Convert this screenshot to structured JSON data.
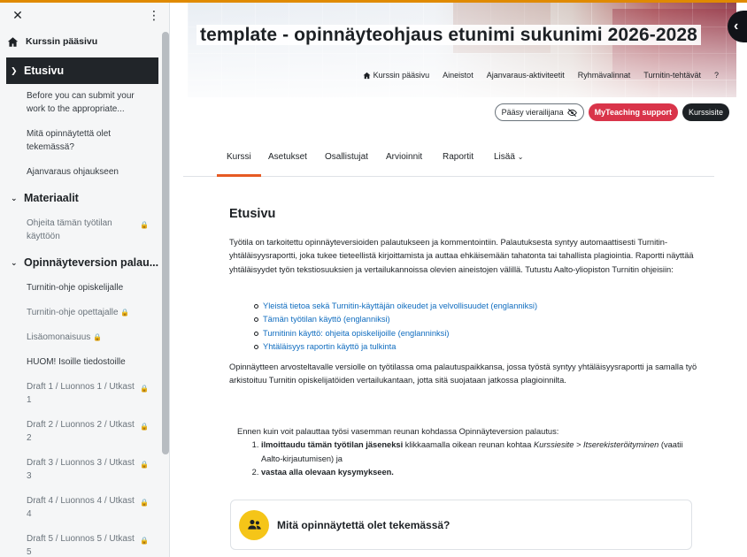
{
  "drawer": {
    "home_label": "Kurssin pääsivu",
    "sections": [
      {
        "title": "Etusivu",
        "active": true,
        "items": [
          {
            "label": "Before you can submit your work to the appropriate...",
            "locked": false
          },
          {
            "label": "Mitä opinnäytettä olet tekemässä?",
            "locked": false
          },
          {
            "label": "Ajanvaraus ohjaukseen",
            "locked": false
          }
        ]
      },
      {
        "title": "Materiaalit",
        "active": false,
        "items": [
          {
            "label": "Ohjeita tämän työtilan käyttöön",
            "locked": true
          }
        ]
      },
      {
        "title": "Opinnäyteversion palau...",
        "active": false,
        "items": [
          {
            "label": "Turnitin-ohje opiskelijalle",
            "locked": false
          },
          {
            "label": "Turnitin-ohje opettajalle",
            "locked": true
          },
          {
            "label": "Lisäomonaisuus",
            "locked": true
          },
          {
            "label": "HUOM! Isoille tiedostoille",
            "locked": false
          },
          {
            "label": "Draft 1 / Luonnos 1 / Utkast 1",
            "locked": true
          },
          {
            "label": "Draft 2 / Luonnos 2 / Utkast 2",
            "locked": true
          },
          {
            "label": "Draft 3 / Luonnos 3 / Utkast 3",
            "locked": true
          },
          {
            "label": "Draft 4 / Luonnos 4 / Utkast 4",
            "locked": true
          },
          {
            "label": "Draft 5 / Luonnos 5 / Utkast 5",
            "locked": true
          }
        ]
      }
    ]
  },
  "header": {
    "title": "template - opinnäyteohjaus etunimi sukunimi 2026-2028",
    "menu": [
      "Kurssin pääsivu",
      "Aineistot",
      "Ajanvaraus-aktiviteetit",
      "Ryhmävalinnat",
      "Turnitin-tehtävät",
      "?"
    ]
  },
  "actions": {
    "guest_access": "Pääsy vierailijana",
    "support": "MyTeaching support",
    "course_page": "Kurssisite"
  },
  "secondary_nav": {
    "tabs": [
      "Kurssi",
      "Asetukset",
      "Osallistujat",
      "Arvioinnit",
      "Raportit",
      "Lisää"
    ],
    "active": "Kurssi"
  },
  "content": {
    "heading": "Etusivu",
    "paragraph1": "Työtila on tarkoitettu opinnäyteversioiden palautukseen ja kommentointiin. Palautuksesta syntyy automaattisesti Turnitin-yhtäläisyysraportti, joka tukee tieteellistä kirjoittamista ja auttaa ehkäisemään tahatonta tai tahallista plagiointia. Raportti näyttää yhtäläisyydet työn tekstiosuuksien ja vertailukannoissa olevien aineistojen välillä. Tutustu Aalto-yliopiston Turnitin ohjeisiin:",
    "links": [
      "Yleistä tietoa sekä Turnitin-käyttäjän oikeudet ja velvollisuudet (englanniksi)",
      "Tämän työtilan käyttö (englanniksi)",
      "Turnitinin käyttö: ohjeita opiskelijoille (englanninksi)",
      "Yhtäläisyys raportin käyttö ja tulkinta"
    ],
    "paragraph2": "Opinnäytteen arvosteltavalle versiolle on työtilassa oma palautuspaikkansa, jossa työstä syntyy yhtäläisyysraportti ja samalla työ arkistoituu Turnitin opiskelijatöiden vertailukantaan, jotta sitä suojataan jatkossa plagioinnilta.",
    "steps_intro": "Ennen kuin voit palauttaa työsi vasemman reunan kohdassa Opinnäyteversion palautus:",
    "step1_bold": "ilmoittaudu tämän työtilan jäseneksi",
    "step1_mid": " klikkaamalla oikean reunan kohtaa ",
    "step1_italic": "Kurssiesite > Itserekisteröityminen",
    "step1_end": " (vaatii Aalto-kirjautumisen) ja",
    "step2_bold": "vastaa alla olevaan kysymykseen.",
    "activity_name": "Mitä opinnäytettä olet tekemässä?"
  },
  "icons": {
    "close": "close-icon",
    "kebab": "kebab-menu-icon",
    "home": "home-icon",
    "chevron": "chevron-down-icon",
    "lock": "lock-icon",
    "eye_slash": "eye-slash-icon",
    "back": "chevron-left-icon",
    "users": "users-icon"
  },
  "colors": {
    "accent_underline": "#e65a23",
    "support_button": "#d9344a",
    "activity_icon_bg": "#f5c518",
    "link": "#0f6cbf",
    "drawer_active_bg": "#212529"
  }
}
